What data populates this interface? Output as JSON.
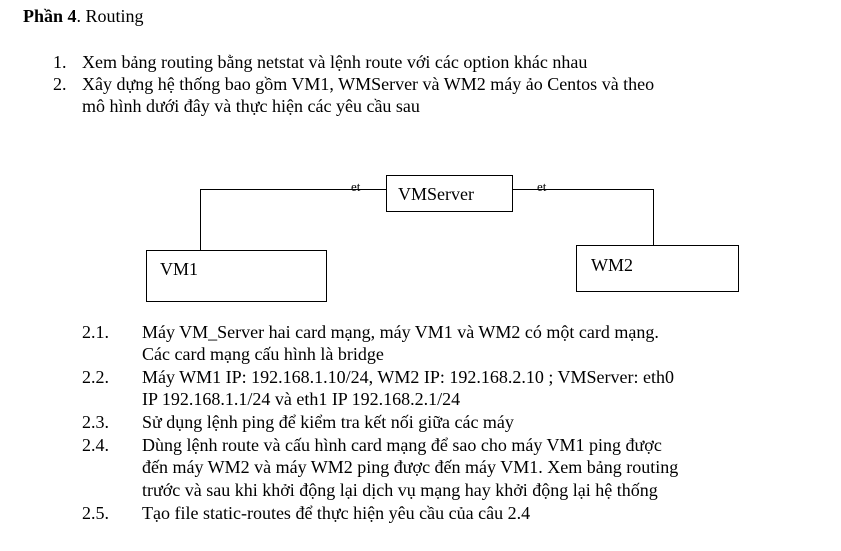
{
  "heading": {
    "bold": "Phần 4",
    "rest": ". Routing"
  },
  "tasks": [
    {
      "num": "1.",
      "lines": [
        "Xem bảng routing bằng netstat và lệnh route với các option khác nhau"
      ]
    },
    {
      "num": "2.",
      "lines": [
        "Xây dựng hệ thống bao gồm  VM1, WMServer và WM2 máy ảo Centos và theo",
        "mô hình dưới đây và thực hiện các yêu cầu sau"
      ]
    }
  ],
  "diagram": {
    "server": "VMServer",
    "vm1": "VM1",
    "wm2": "WM2",
    "left_link_label": "et",
    "right_link_label": "et"
  },
  "subtasks": [
    {
      "num": "2.1.",
      "lines": [
        "Máy VM_Server hai card mạng, máy VM1 và  WM2 có một card mạng.",
        "Các card mạng cấu hình là bridge"
      ]
    },
    {
      "num": "2.2.",
      "lines": [
        "Máy WM1 IP: 192.168.1.10/24, WM2 IP: 192.168.2.10 ; VMServer: eth0",
        "IP 192.168.1.1/24 và eth1 IP 192.168.2.1/24"
      ]
    },
    {
      "num": "2.3.",
      "lines": [
        "Sử dụng lệnh ping để kiểm tra kết nối giữa các máy"
      ]
    },
    {
      "num": "2.4.",
      "lines": [
        "Dùng lệnh route và cấu hình card mạng để sao cho máy VM1 ping được",
        "đến máy WM2 và máy WM2 ping được đến máy VM1. Xem bảng routing",
        "trước và sau khi khởi động lại dịch vụ mạng hay khởi động lại hệ thống"
      ]
    },
    {
      "num": "2.5.",
      "lines": [
        "Tạo file static-routes để thực hiện yêu cầu của câu 2.4"
      ]
    }
  ]
}
